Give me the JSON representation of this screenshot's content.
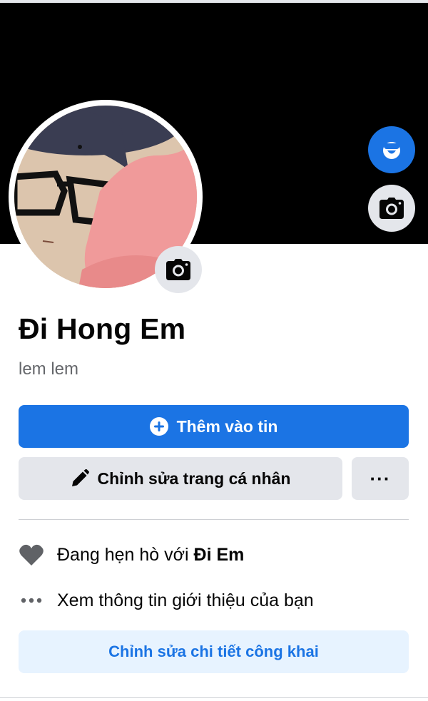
{
  "profile": {
    "name": "Đi Hong Em",
    "bio": "lem lem"
  },
  "actions": {
    "add_story_label": "Thêm vào tin",
    "edit_profile_label": "Chỉnh sửa trang cá nhân",
    "more_label": "···",
    "edit_public_details_label": "Chỉnh sửa chi tiết công khai"
  },
  "details": {
    "relationship_prefix": "Đang hẹn hò với",
    "relationship_partner": "Đi Em",
    "about_label": "Xem thông tin giới thiệu của bạn"
  },
  "icons": {
    "avatar_button": "avatar-icon",
    "cover_camera": "camera-icon",
    "profile_camera": "camera-icon",
    "add": "plus-circle-icon",
    "edit": "pencil-icon",
    "relationship": "heart-icon",
    "about": "more-dots-icon"
  },
  "colors": {
    "accent": "#1b74e4",
    "cover": "#000000",
    "button_gray": "#e4e6eb",
    "light_button": "#e7f3ff"
  }
}
